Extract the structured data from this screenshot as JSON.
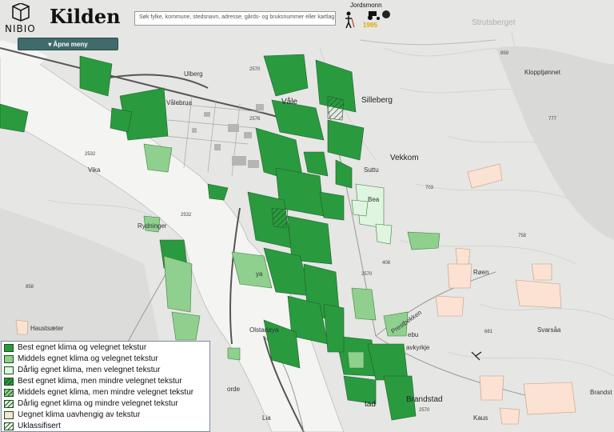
{
  "header": {
    "logo_text": "NIBIO",
    "title": "Kilden",
    "search_placeholder": "Søk fylke, kommune, stedsnavn, adresse, gårds- og bruksnummer eller kartlag.",
    "layer_label": "Jordsmonn",
    "layer_year": "1995"
  },
  "menu": {
    "open_label": "▾ Åpne meny"
  },
  "legend": {
    "items": [
      {
        "label": "Best egnet klima og velegnet tekstur",
        "color": "#2a9a3f",
        "hatch": false
      },
      {
        "label": "Middels egnet klima og velegnet tekstur",
        "color": "#8fd08f",
        "hatch": false
      },
      {
        "label": "Dårlig egnet klima, men velegnet tekstur",
        "color": "#dff5df",
        "hatch": false
      },
      {
        "label": "Best egnet klima, men mindre velegnet tekstur",
        "color": "#2a9a3f",
        "hatch": true
      },
      {
        "label": "Middels egnet klima, men mindre velegnet tekstur",
        "color": "#8fd08f",
        "hatch": true
      },
      {
        "label": "Dårlig egnet klima og mindre velegnet tekstur",
        "color": "#dff5df",
        "hatch": true
      },
      {
        "label": "Uegnet klima uavhengig av tekstur",
        "color": "#fbe2d2",
        "hatch": false
      },
      {
        "label": "Uklassifisert",
        "color": "#ffffff",
        "hatch": true
      }
    ]
  },
  "map_labels": {
    "strutsberget": "Strutsberget",
    "kloppt": "Klopptjønnet",
    "ulberg": "Ulberg",
    "valebrua": "Vålebrua",
    "vale": "Våle",
    "silleberg": "Silleberg",
    "vekkom": "Vekkom",
    "suttu": "Suttu",
    "bea": "Bea",
    "vika": "Vika",
    "rydninger": "Rydninger",
    "roen": "Røen",
    "svarsaa": "Svarsåa",
    "haustsaeter": "Haustsæter",
    "olstadoya": "Olstadøya",
    "ya": "ya",
    "brandstad": "Brandstad",
    "brandst": "Brandst",
    "avkyrkje": "avkyrkje",
    "prestbekken": "Prestbekken",
    "ebu": "ebu",
    "orde": "orde",
    "lia": "Lia",
    "kaus": "Kaus",
    "tad": "tad",
    "n2570a": "2570",
    "n2576": "2576",
    "n2532a": "2532",
    "n2532b": "2532",
    "n2570b": "2570",
    "n2570c": "2570",
    "n859": "859",
    "n777": "777",
    "n703": "703",
    "n758": "758",
    "n858": "858",
    "n681": "681",
    "n408": "408"
  }
}
